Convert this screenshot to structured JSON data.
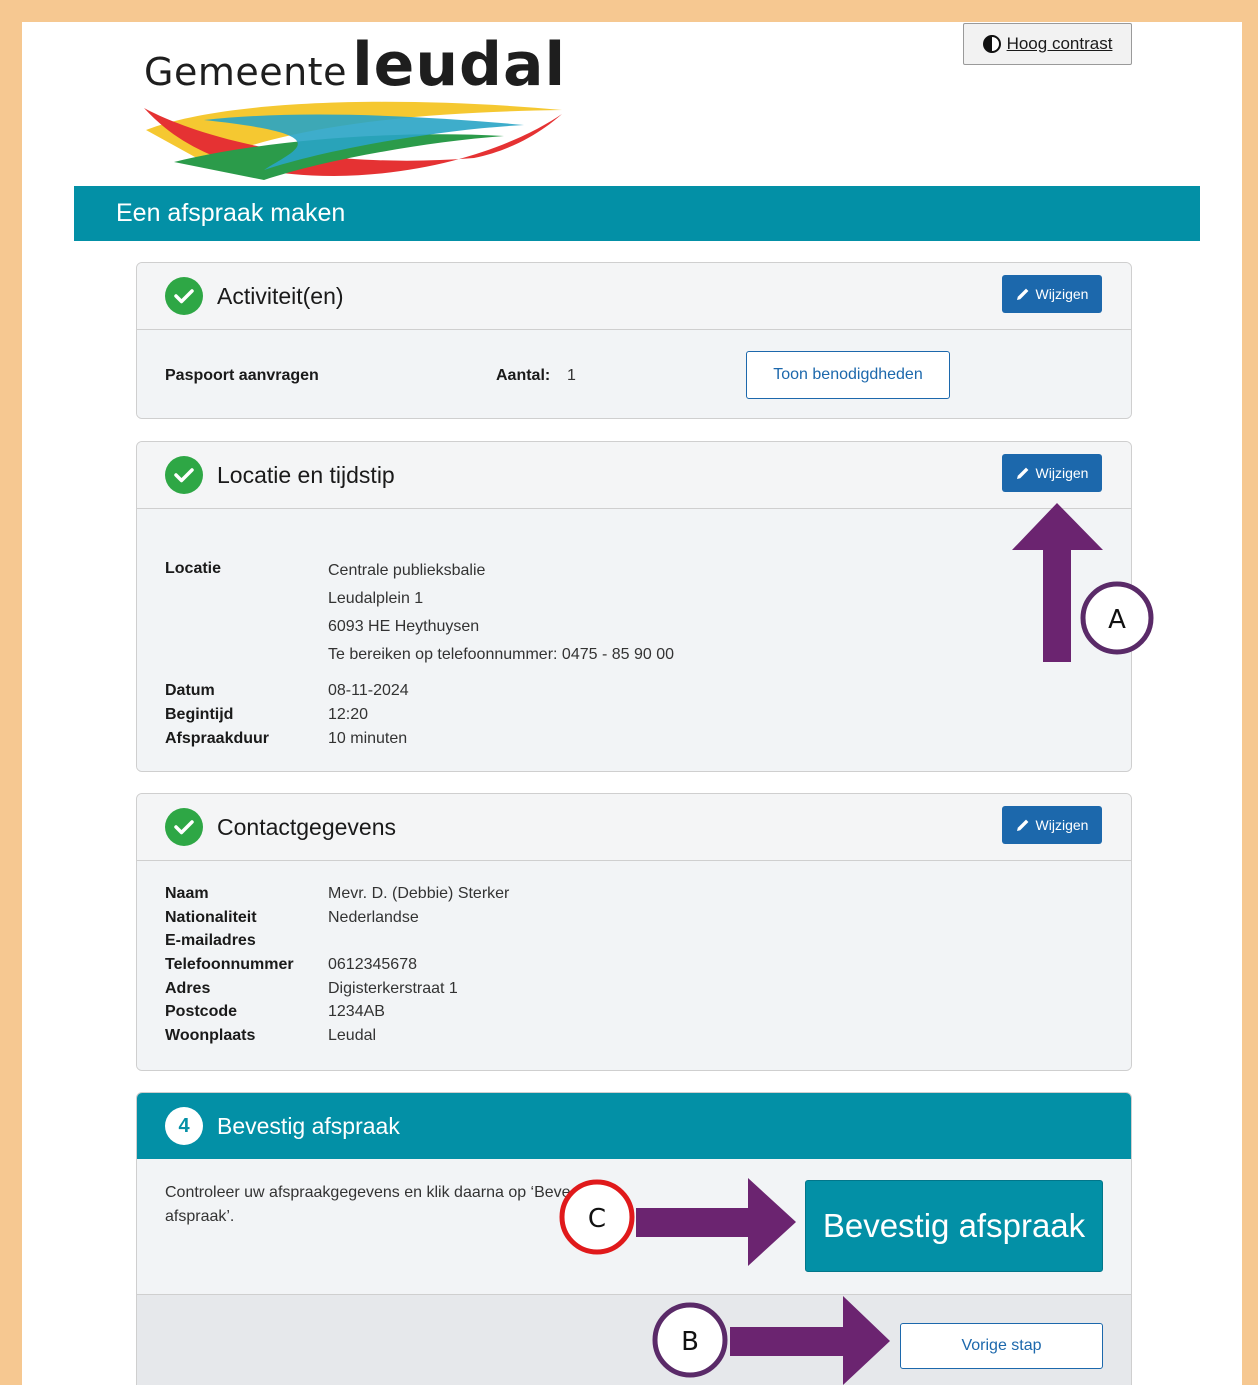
{
  "header": {
    "logo_prefix": "Gemeente",
    "logo_name": "leudal",
    "contrast_button": "Hoog contrast",
    "banner_title": "Een afspraak maken"
  },
  "activities": {
    "title": "Activiteit(en)",
    "edit_label": "Wijzigen",
    "item": "Paspoort aanvragen",
    "count_label": "Aantal:",
    "count_value": "1",
    "requirements_button": "Toon benodigdheden"
  },
  "location": {
    "title": "Locatie en tijdstip",
    "edit_label": "Wijzigen",
    "location_label": "Locatie",
    "location_lines": [
      "Centrale publieksbalie",
      "Leudalplein 1",
      "6093 HE Heythuysen",
      "Te bereiken op telefoonnummer: 0475 - 85 90 00"
    ],
    "date_label": "Datum",
    "date_value": "08-11-2024",
    "start_label": "Begintijd",
    "start_value": "12:20",
    "duration_label": "Afspraakduur",
    "duration_value": "10 minuten"
  },
  "contact": {
    "title": "Contactgegevens",
    "edit_label": "Wijzigen",
    "fields": [
      {
        "label": "Naam",
        "value": "Mevr. D. (Debbie) Sterker"
      },
      {
        "label": "Nationaliteit",
        "value": "Nederlandse"
      },
      {
        "label": "E-mailadres",
        "value": ""
      },
      {
        "label": "Telefoonnummer",
        "value": "0612345678"
      },
      {
        "label": "Adres",
        "value": "Digisterkerstraat 1"
      },
      {
        "label": "Postcode",
        "value": "1234AB"
      },
      {
        "label": "Woonplaats",
        "value": "Leudal"
      }
    ]
  },
  "confirm": {
    "step_number": "4",
    "title": "Bevestig afspraak",
    "instruction_line1": "Controleer uw afspraakgegevens en klik daarna op ‘Bevestig",
    "instruction_line2": "afspraak’.",
    "confirm_button": "Bevestig afspraak",
    "previous_button": "Vorige stap"
  },
  "annotations": {
    "marker_a": "A",
    "marker_b": "B",
    "marker_c": "C",
    "arrow_color": "#6b2470",
    "marker_c_color": "#e0191b",
    "marker_ab_color": "#5a2a68"
  },
  "colors": {
    "teal": "#0390a6",
    "blue": "#1c68ac",
    "green": "#2ea745",
    "frame": "#f6c891"
  }
}
